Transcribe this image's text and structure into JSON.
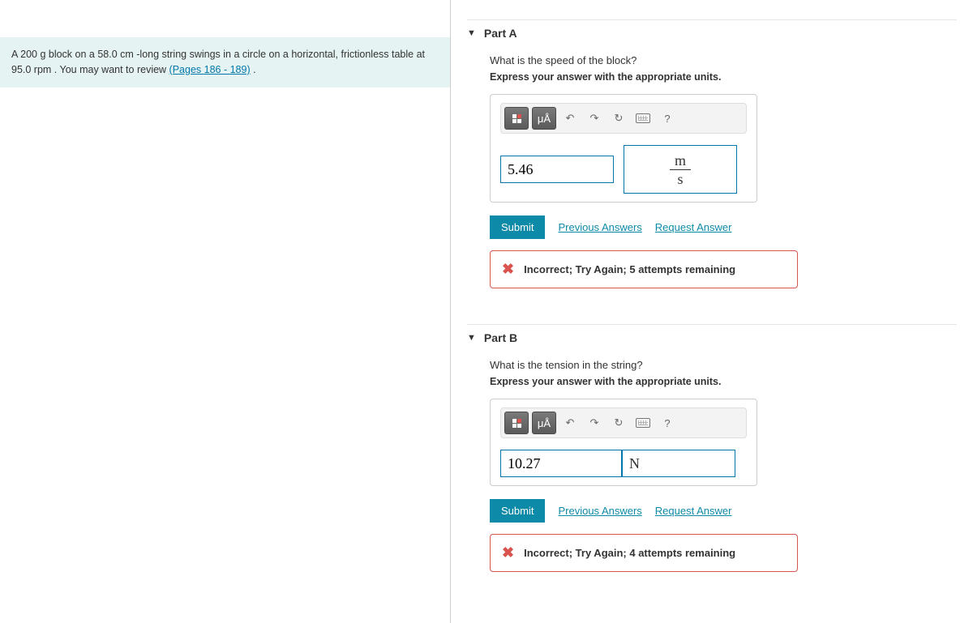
{
  "problem": {
    "text_before_link": "A 200 g block on a 58.0 cm -long string swings in a circle on a horizontal, frictionless table at 95.0 rpm . You may want to review ",
    "link_text": "(Pages 186 - 189)",
    "text_after_link": " ."
  },
  "partA": {
    "title": "Part A",
    "question": "What is the speed of the block?",
    "hint": "Express your answer with the appropriate units.",
    "toolbar": {
      "units_btn": "μÅ",
      "help": "?"
    },
    "value": "5.46",
    "unit_num": "m",
    "unit_den": "s",
    "submit": "Submit",
    "prev": "Previous Answers",
    "req": "Request Answer",
    "feedback": "Incorrect; Try Again; 5 attempts remaining"
  },
  "partB": {
    "title": "Part B",
    "question": "What is the tension in the string?",
    "hint": "Express your answer with the appropriate units.",
    "toolbar": {
      "units_btn": "μÅ",
      "help": "?"
    },
    "value": "10.27",
    "unit": "N",
    "submit": "Submit",
    "prev": "Previous Answers",
    "req": "Request Answer",
    "feedback": "Incorrect; Try Again; 4 attempts remaining"
  }
}
